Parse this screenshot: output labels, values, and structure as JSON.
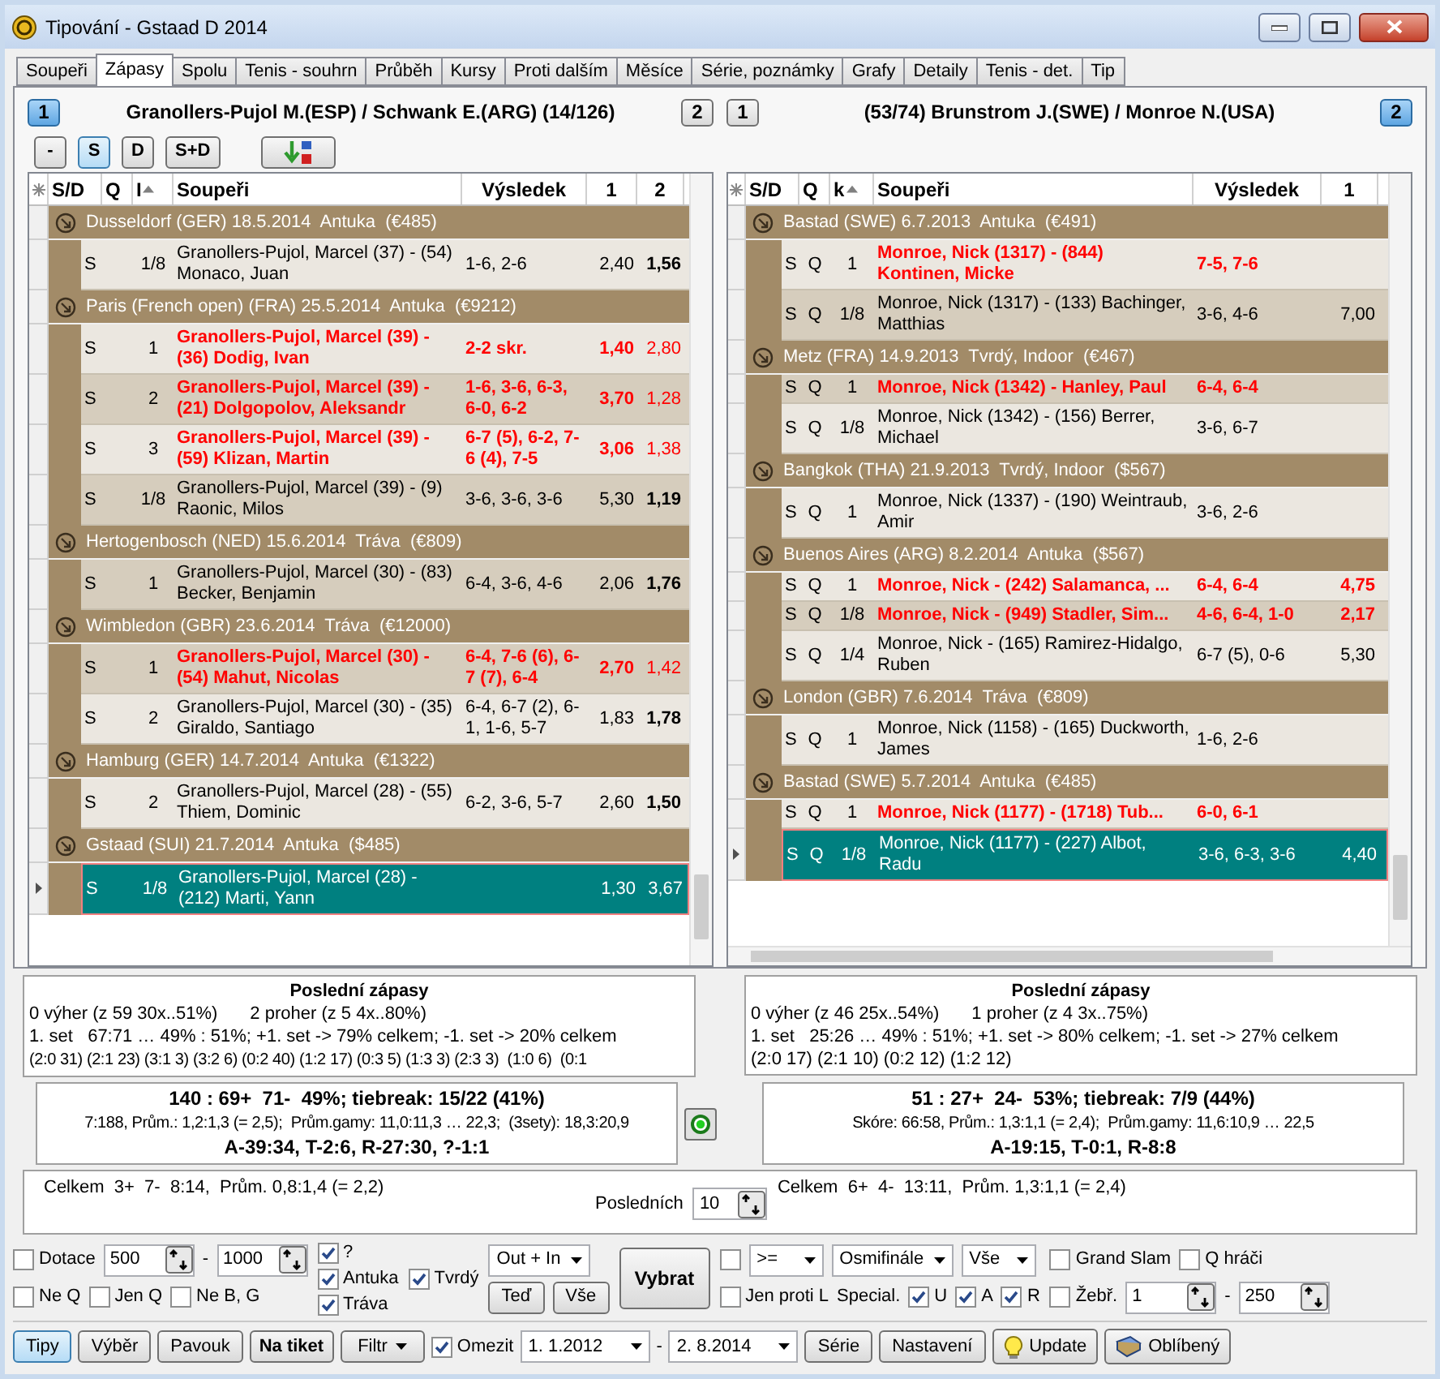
{
  "window": {
    "title": "Tipování - Gstaad D 2014"
  },
  "tabs": [
    {
      "label": "Soupeři",
      "selected": false
    },
    {
      "label": "Zápasy",
      "selected": true
    },
    {
      "label": "Spolu",
      "selected": false
    },
    {
      "label": "Tenis - souhrn",
      "selected": false
    },
    {
      "label": "Průběh",
      "selected": false
    },
    {
      "label": "Kursy",
      "selected": false
    },
    {
      "label": "Proti dalším",
      "selected": false
    },
    {
      "label": "Měsíce",
      "selected": false
    },
    {
      "label": "Série, poznámky",
      "selected": false
    },
    {
      "label": "Grafy",
      "selected": false
    },
    {
      "label": "Detaily",
      "selected": false
    },
    {
      "label": "Tenis - det.",
      "selected": false
    },
    {
      "label": "Tip",
      "selected": false
    }
  ],
  "panels": [
    {
      "player_buttons": [
        {
          "label": "1",
          "selected": true
        },
        {
          "label": "2",
          "selected": false
        }
      ],
      "title": "Granollers-Pujol M.(ESP) / Schwank E.(ARG) (14/126)",
      "filter_buttons": [
        {
          "label": "-",
          "selected": false
        },
        {
          "label": "S",
          "selected": true
        },
        {
          "label": "D",
          "selected": false
        },
        {
          "label": "S+D",
          "selected": false
        }
      ],
      "columns": [
        {
          "label": "S/D",
          "sorted": false
        },
        {
          "label": "Q",
          "sorted": false
        },
        {
          "label": "I",
          "sorted": true
        },
        {
          "label": "Soupeři",
          "sorted": false
        },
        {
          "label": "Výsledek",
          "sorted": false
        },
        {
          "label": "1",
          "sorted": false
        },
        {
          "label": "2",
          "sorted": false
        }
      ],
      "groups": [
        {
          "title": "Dusseldorf (GER) 18.5.2014  Antuka  (€485)",
          "rows": [
            {
              "kind": "normal",
              "shaded": false,
              "sd": "S",
              "round": "1/8",
              "opponent": "Granollers-Pujol, Marcel (37) - (54) Monaco, Juan",
              "result": "1-6, 2-6",
              "odds": [
                {
                  "text": "2,40",
                  "bold": false
                },
                {
                  "text": "1,56",
                  "bold": true
                }
              ]
            }
          ]
        },
        {
          "title": "Paris (French open) (FRA) 25.5.2014  Antuka  (€9212)",
          "rows": [
            {
              "kind": "red",
              "shaded": false,
              "sd": "S",
              "round": "1",
              "opponent": "Granollers-Pujol, Marcel (39) - (36) Dodig, Ivan",
              "result": "2-2 skr.",
              "odds": [
                {
                  "text": "1,40",
                  "bold": true
                },
                {
                  "text": "2,80",
                  "bold": false
                }
              ]
            },
            {
              "kind": "red",
              "shaded": true,
              "sd": "S",
              "round": "2",
              "opponent": "Granollers-Pujol, Marcel (39) - (21) Dolgopolov, Aleksandr",
              "result": "1-6, 3-6, 6-3, 6-0, 6-2",
              "odds": [
                {
                  "text": "3,70",
                  "bold": true
                },
                {
                  "text": "1,28",
                  "bold": false
                }
              ]
            },
            {
              "kind": "red",
              "shaded": false,
              "sd": "S",
              "round": "3",
              "opponent": "Granollers-Pujol, Marcel (39) - (59) Klizan, Martin",
              "result": "6-7 (5), 6-2, 7-6 (4), 7-5",
              "odds": [
                {
                  "text": "3,06",
                  "bold": true
                },
                {
                  "text": "1,38",
                  "bold": false
                }
              ]
            },
            {
              "kind": "normal",
              "shaded": true,
              "sd": "S",
              "round": "1/8",
              "opponent": "Granollers-Pujol, Marcel (39) - (9) Raonic, Milos",
              "result": "3-6, 3-6, 3-6",
              "odds": [
                {
                  "text": "5,30",
                  "bold": false
                },
                {
                  "text": "1,19",
                  "bold": true
                }
              ]
            }
          ]
        },
        {
          "title": "Hertogenbosch (NED) 15.6.2014  Tráva  (€809)",
          "rows": [
            {
              "kind": "normal",
              "shaded": true,
              "sd": "S",
              "round": "1",
              "opponent": "Granollers-Pujol, Marcel (30) - (83) Becker, Benjamin",
              "result": "6-4, 3-6, 4-6",
              "odds": [
                {
                  "text": "2,06",
                  "bold": false
                },
                {
                  "text": "1,76",
                  "bold": true
                }
              ]
            }
          ]
        },
        {
          "title": "Wimbledon (GBR) 23.6.2014  Tráva  (€12000)",
          "rows": [
            {
              "kind": "red",
              "shaded": true,
              "sd": "S",
              "round": "1",
              "opponent": "Granollers-Pujol, Marcel (30) - (54) Mahut, Nicolas",
              "result": "6-4, 7-6 (6), 6-7 (7), 6-4",
              "odds": [
                {
                  "text": "2,70",
                  "bold": true
                },
                {
                  "text": "1,42",
                  "bold": false
                }
              ]
            },
            {
              "kind": "normal",
              "shaded": false,
              "sd": "S",
              "round": "2",
              "opponent": "Granollers-Pujol, Marcel (30) - (35) Giraldo, Santiago",
              "result": "6-4, 6-7 (2), 6-1, 1-6, 5-7",
              "odds": [
                {
                  "text": "1,83",
                  "bold": false
                },
                {
                  "text": "1,78",
                  "bold": true
                }
              ]
            }
          ]
        },
        {
          "title": "Hamburg (GER) 14.7.2014  Antuka  (€1322)",
          "rows": [
            {
              "kind": "normal",
              "shaded": false,
              "sd": "S",
              "round": "2",
              "opponent": "Granollers-Pujol, Marcel (28) - (55) Thiem, Dominic",
              "result": "6-2, 3-6, 5-7",
              "odds": [
                {
                  "text": "2,60",
                  "bold": false
                },
                {
                  "text": "1,50",
                  "bold": true
                }
              ]
            }
          ]
        },
        {
          "title": "Gstaad (SUI) 21.7.2014  Antuka  ($485)",
          "rows": [
            {
              "kind": "current",
              "sd": "S",
              "round": "1/8",
              "opponent": "Granollers-Pujol, Marcel (28) - (212) Marti, Yann",
              "odds": [
                {
                  "text": "1,30",
                  "bold": false
                },
                {
                  "text": "3,67",
                  "bold": false
                }
              ]
            }
          ]
        }
      ]
    },
    {
      "player_buttons": [
        {
          "label": "1",
          "selected": false
        },
        {
          "label": "2",
          "selected": true
        }
      ],
      "title": "(53/74) Brunstrom J.(SWE) / Monroe N.(USA)",
      "columns": [
        {
          "label": "S/D",
          "sorted": false
        },
        {
          "label": "Q",
          "sorted": false
        },
        {
          "label": "k",
          "sorted": true
        },
        {
          "label": "Soupeři",
          "sorted": false
        },
        {
          "label": "Výsledek",
          "sorted": false
        },
        {
          "label": "1",
          "sorted": false
        }
      ],
      "groups": [
        {
          "title": "Bastad (SWE) 6.7.2013  Antuka  (€491)",
          "rows": [
            {
              "kind": "red",
              "shaded": false,
              "sd": "S",
              "q": "Q",
              "round": "1",
              "opponent": "Monroe, Nick (1317) - (844) Kontinen, Micke",
              "result": "7-5, 7-6",
              "odds": []
            },
            {
              "kind": "normal",
              "shaded": true,
              "sd": "S",
              "q": "Q",
              "round": "1/8",
              "opponent": "Monroe, Nick (1317) - (133) Bachinger, Matthias",
              "result": "3-6, 4-6",
              "odds": [
                {
                  "text": "7,00",
                  "bold": false
                }
              ]
            }
          ]
        },
        {
          "title": "Metz (FRA) 14.9.2013  Tvrdý, Indoor  (€467)",
          "rows": [
            {
              "kind": "red",
              "shaded": true,
              "sd": "S",
              "q": "Q",
              "round": "1",
              "opponent": "Monroe, Nick (1342) - Hanley, Paul",
              "result": "6-4, 6-4",
              "odds": []
            },
            {
              "kind": "normal",
              "shaded": false,
              "sd": "S",
              "q": "Q",
              "round": "1/8",
              "opponent": "Monroe, Nick (1342) - (156) Berrer, Michael",
              "result": "3-6, 6-7",
              "odds": []
            }
          ]
        },
        {
          "title": "Bangkok (THA) 21.9.2013  Tvrdý, Indoor  ($567)",
          "rows": [
            {
              "kind": "normal",
              "shaded": false,
              "sd": "S",
              "q": "Q",
              "round": "1",
              "opponent": "Monroe, Nick (1337) - (190) Weintraub, Amir",
              "result": "3-6, 2-6",
              "odds": []
            }
          ]
        },
        {
          "title": "Buenos Aires (ARG) 8.2.2014  Antuka  ($567)",
          "rows": [
            {
              "kind": "red",
              "shaded": false,
              "sd": "S",
              "q": "Q",
              "round": "1",
              "opponent": "Monroe, Nick - (242) Salamanca, ...",
              "result": "6-4, 6-4",
              "odds": [
                {
                  "text": "4,75",
                  "bold": true
                }
              ]
            },
            {
              "kind": "red",
              "shaded": true,
              "sd": "S",
              "q": "Q",
              "round": "1/8",
              "opponent": "Monroe, Nick - (949) Stadler, Sim...",
              "result": "4-6, 6-4, 1-0",
              "odds": [
                {
                  "text": "2,17",
                  "bold": true
                }
              ]
            },
            {
              "kind": "normal",
              "shaded": false,
              "sd": "S",
              "q": "Q",
              "round": "1/4",
              "opponent": "Monroe, Nick - (165) Ramirez-Hidalgo, Ruben",
              "result": "6-7 (5), 0-6",
              "odds": [
                {
                  "text": "5,30",
                  "bold": false
                }
              ]
            }
          ]
        },
        {
          "title": "London (GBR) 7.6.2014  Tráva  (€809)",
          "rows": [
            {
              "kind": "normal",
              "shaded": false,
              "sd": "S",
              "q": "Q",
              "round": "1",
              "opponent": "Monroe, Nick (1158) - (165) Duckworth, James",
              "result": "1-6, 2-6",
              "odds": []
            }
          ]
        },
        {
          "title": "Bastad (SWE) 5.7.2014  Antuka  (€485)",
          "rows": [
            {
              "kind": "red",
              "shaded": false,
              "sd": "S",
              "q": "Q",
              "round": "1",
              "opponent": "Monroe, Nick (1177) - (1718) Tub...",
              "result": "6-0, 6-1",
              "odds": []
            },
            {
              "kind": "current",
              "sd": "S",
              "q": "Q",
              "round": "1/8",
              "opponent": "Monroe, Nick (1177) - (227) Albot, Radu",
              "result": "3-6, 6-3, 3-6",
              "odds": [
                {
                  "text": "4,40",
                  "bold": false
                }
              ]
            }
          ]
        }
      ]
    }
  ],
  "stats": [
    {
      "title": "Poslední zápasy",
      "wins": "0 výher (z 59 30x..51%)",
      "losses": "2 proher (z 5 4x..80%)",
      "set_line": "1. set   67:71 … 49% : 51%; +1. set -> 79% celkem; -1. set -> 20% celkem",
      "scores": "(2:0 31) (2:1 23) (3:1 3) (3:2 6) (0:2 40) (1:2 17) (0:3 5) (1:3 3) (2:3 3)  (1:0 6)  (0:1"
    },
    {
      "title": "Poslední zápasy",
      "wins": "0 výher (z 46 25x..54%)",
      "losses": "1 proher (z 4 3x..75%)",
      "set_line": "1. set   25:26 … 49% : 51%; +1. set -> 80% celkem; -1. set -> 27% celkem",
      "scores": "(2:0 17) (2:1 10) (0:2 12) (1:2 12)"
    }
  ],
  "summaries": [
    {
      "headline": "140 : 69+  71-  49%; tiebreak: 15/22 (41%)",
      "details": "7:188, Prům.: 1,2:1,3 (= 2,5);  Prům.gamy: 11,0:11,3 … 22,3;  (3sety): 18,3:20,9",
      "surfaces": "A-39:34, T-2:6, R-27:30, ?-1:1"
    },
    {
      "headline": "51 : 27+  24-  53%; tiebreak: 7/9 (44%)",
      "details": "Skóre: 66:58, Prům.: 1,3:1,1 (= 2,4);  Prům.gamy: 11,6:10,9 … 22,5",
      "surfaces": "A-19:15, T-0:1, R-8:8"
    }
  ],
  "totals": {
    "left": "Celkem  3+  7-  8:14,  Prům. 0,8:1,4 (= 2,2)",
    "last_label": "Posledních",
    "last_value": "10",
    "right": "Celkem  6+  4-  13:11,  Prům. 1,3:1,1 (= 2,4)"
  },
  "filters": [
    {
      "lines": [
        {
          "items": [
            {
              "kind": "checkbox",
              "label": "Dotace",
              "checked": false
            },
            {
              "kind": "spin",
              "value": "500"
            },
            {
              "kind": "text",
              "label": "-"
            },
            {
              "kind": "spin",
              "value": "1000"
            }
          ]
        },
        {
          "items": [
            {
              "kind": "checkbox",
              "label": "Ne Q",
              "checked": false
            },
            {
              "kind": "checkbox",
              "label": "Jen Q",
              "checked": false
            },
            {
              "kind": "checkbox",
              "label": "Ne B, G",
              "checked": false
            }
          ]
        }
      ]
    },
    {
      "lines": [
        {
          "items": [
            {
              "kind": "checkbox",
              "label": "?",
              "checked": true
            }
          ]
        },
        {
          "items": [
            {
              "kind": "checkbox",
              "label": "Antuka",
              "checked": true
            }
          ]
        },
        {
          "items": [
            {
              "kind": "checkbox",
              "label": "Tráva",
              "checked": true
            }
          ]
        }
      ]
    },
    {
      "lines": [
        {
          "items": [
            {
              "kind": "checkbox",
              "label": "Tvrdý",
              "checked": true
            }
          ]
        }
      ]
    },
    {
      "lines": [
        {
          "items": [
            {
              "kind": "select",
              "value": "Out + In"
            }
          ]
        },
        {
          "items": [
            {
              "kind": "button",
              "label": "Teď"
            },
            {
              "kind": "button",
              "label": "Vše"
            }
          ]
        }
      ]
    },
    {
      "lines": [
        {
          "items": [
            {
              "kind": "main_button",
              "label": "Vybrat"
            }
          ]
        }
      ]
    },
    {
      "lines": [
        {
          "items": [
            {
              "kind": "checkbox",
              "checked": false
            },
            {
              "kind": "select",
              "value": ">="
            },
            {
              "kind": "select",
              "value": "Osmifinále"
            },
            {
              "kind": "select",
              "value": "Vše"
            }
          ]
        },
        {
          "items": [
            {
              "kind": "checkbox",
              "label": "Jen proti L",
              "checked": false
            },
            {
              "kind": "text",
              "label": "Special."
            },
            {
              "kind": "checkbox",
              "label": "U",
              "checked": true
            },
            {
              "kind": "checkbox",
              "label": "A",
              "checked": true
            },
            {
              "kind": "checkbox",
              "label": "R",
              "checked": true
            }
          ]
        }
      ]
    },
    {
      "lines": [
        {
          "items": [
            {
              "kind": "checkbox",
              "label": "Grand Slam",
              "checked": false
            },
            {
              "kind": "checkbox",
              "label": "Q hráči",
              "checked": false
            }
          ]
        },
        {
          "items": [
            {
              "kind": "checkbox",
              "label": "Žebř.",
              "checked": false
            },
            {
              "kind": "spin",
              "value": "1"
            },
            {
              "kind": "text",
              "label": "-"
            },
            {
              "kind": "spin",
              "value": "250"
            }
          ]
        }
      ]
    }
  ],
  "toolbar": [
    {
      "kind": "button",
      "label": "Tipy",
      "selected": true
    },
    {
      "kind": "button",
      "label": "Výběr",
      "selected": false
    },
    {
      "kind": "button",
      "label": "Pavouk",
      "selected": false
    },
    {
      "kind": "strong_button",
      "label": "Na tiket",
      "selected": false
    },
    {
      "kind": "menu_button",
      "label": "Filtr",
      "selected": false
    },
    {
      "kind": "checkbox",
      "label": "Omezit",
      "checked": true
    },
    {
      "kind": "date",
      "value": "1. 1.2012"
    },
    {
      "kind": "text",
      "label": "-"
    },
    {
      "kind": "date",
      "value": "2. 8.2014"
    },
    {
      "kind": "button",
      "label": "Série",
      "selected": false
    },
    {
      "kind": "button",
      "label": "Nastavení",
      "selected": false
    },
    {
      "kind": "bulb_button",
      "label": "Update",
      "selected": false
    },
    {
      "kind": "book_button",
      "label": "Oblíbený",
      "selected": false
    }
  ]
}
